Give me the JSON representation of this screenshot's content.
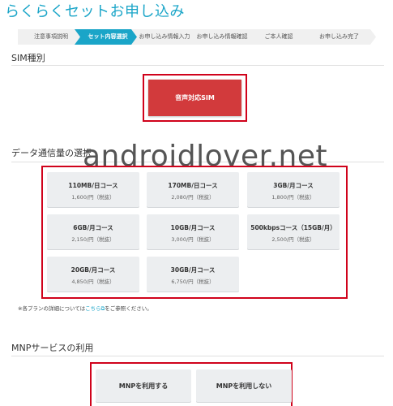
{
  "page": {
    "title": "らくらくセットお申し込み"
  },
  "steps": [
    {
      "label": "注意事項説明"
    },
    {
      "label": "セット内容選択",
      "active": true
    },
    {
      "label": "お申し込み情報入力"
    },
    {
      "label": "お申し込み情報確認"
    },
    {
      "label": "ご本人確認"
    },
    {
      "label": "お申し込み完了"
    }
  ],
  "sim": {
    "section_title": "SIM種別",
    "option_label": "音声対応SIM"
  },
  "data_plans": {
    "section_title": "データ通信量の選択",
    "plans": [
      {
        "name": "110MB/日コース",
        "price": "1,600/円（税抜）"
      },
      {
        "name": "170MB/日コース",
        "price": "2,080/円（税抜）"
      },
      {
        "name": "3GB/月コース",
        "price": "1,800/円（税抜）"
      },
      {
        "name": "6GB/月コース",
        "price": "2,150/円（税抜）"
      },
      {
        "name": "10GB/月コース",
        "price": "3,000/円（税抜）"
      },
      {
        "name": "500kbpsコース（15GB/月）",
        "price": "2,500/円（税抜）"
      },
      {
        "name": "20GB/月コース",
        "price": "4,850/円（税抜）"
      },
      {
        "name": "30GB/月コース",
        "price": "6,750/円（税抜）"
      }
    ],
    "note_prefix": "※各プランの詳細については",
    "note_link": "こちら",
    "note_suffix": "をご参照ください。"
  },
  "mnp": {
    "section_title": "MNPサービスの利用",
    "use_label": "MNPを利用する",
    "not_use_label": "MNPを利用しない"
  },
  "watermark": {
    "text": "androidlover.net"
  },
  "colors": {
    "accent": "#1aa5c8",
    "sim_selected": "#d23a3c",
    "highlight_frame": "#d0021b"
  }
}
